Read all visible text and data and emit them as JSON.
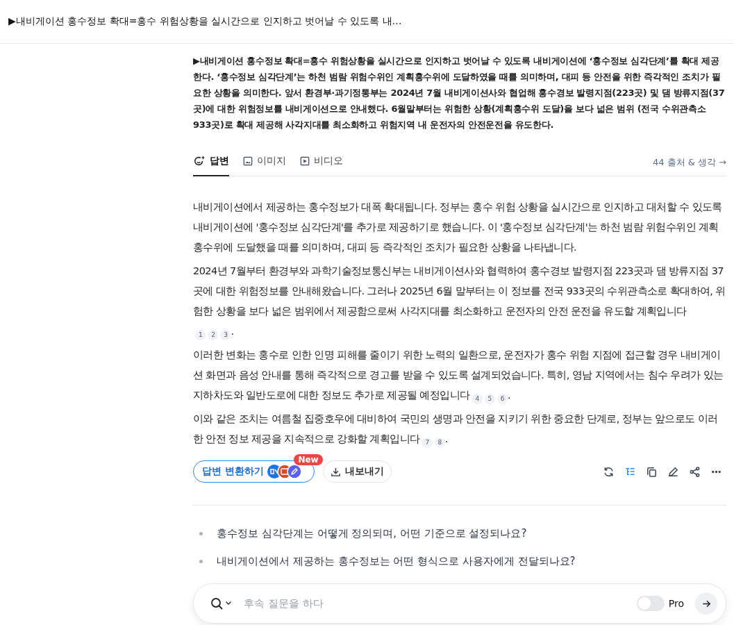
{
  "header": {
    "title": "▶내비게이션 홍수정보 확대=홍수 위험상황을 실시간으로 인지하고 벗어날 수 있도록 내…"
  },
  "query": "▶내비게이션 홍수정보 확대=홍수 위험상황을 실시간으로 인지하고 벗어날 수 있도록 내비게이션에 ‘홍수정보 심각단계’를 확대 제공한다. ‘홍수정보 심각단계’는 하천 범람 위험수위인 계획홍수위에 도달하였을 때를 의미하며, 대피 등 안전을 위한 즉각적인 조치가 필요한 상황을 의미한다. 앞서 환경부·과기정통부는 2024년 7월 내비게이션사와 협업해 홍수경보 발령지점(223곳) 및 댐 방류지점(37곳)에 대한 위험정보를 내비게이션으로 안내했다. 6월말부터는 위험한 상황(계획홍수위 도달)을 보다 넓은 범위 (전국 수위관측소 933곳)로 확대 제공해 사각지대를 최소화하고 위험지역 내 운전자의 안전운전을 유도한다.",
  "tabs": [
    {
      "label": "답변",
      "kind": "answer",
      "selected": true
    },
    {
      "label": "이미지",
      "kind": "images",
      "selected": false
    },
    {
      "label": "비디오",
      "kind": "video",
      "selected": false
    }
  ],
  "sources_link": "44 출처 & 생각 →",
  "paragraphs": [
    {
      "text": "내비게이션에서 제공하는 홍수정보가 대폭 확대됩니다. 정부는 홍수 위험 상황을 실시간으로 인지하고 대처할 수 있도록 내비게이션에 '홍수정보 심각단계'를 추가로 제공하기로 했습니다. 이 '홍수정보 심각단계'는 하천 범람 위험수위인 계획홍수위에 도달했을 때를 의미하며, 대피 등 즉각적인 조치가 필요한 상황을 나타냅니다."
    },
    {
      "text": "2024년 7월부터 환경부와 과학기술정보통신부는 내비게이션사와 협력하여 홍수경보 발령지점 223곳과 댐 방류지점 37곳에 대한 위험정보를 안내해왔습니다. 그러나 2025년 6월 말부터는 이 정보를 전국 933곳의 수위관측소로 확대하여, 위험한 상황을 보다 넓은 범위에서 제공함으로써 사각지대를 최소화하고 운전자의 안전 운전을 유도할 계획입니다",
      "citations": [
        "1",
        "2",
        "3"
      ],
      "end": "."
    },
    {
      "text": "이러한 변화는 홍수로 인한 인명 피해를 줄이기 위한 노력의 일환으로, 운전자가 홍수 위험 지점에 접근할 경우 내비게이션 화면과 음성 안내를 통해 즉각적으로 경고를 받을 수 있도록 설계되었습니다. 특히, 영남 지역에서는 침수 우려가 있는 지하차도와 일반도로에 대한 정보도 추가로 제공될 예정입니다",
      "citations": [
        "4",
        "5",
        "6"
      ],
      "end": "."
    },
    {
      "text": "이와 같은 조치는 여름철 집중호우에 대비하여 국민의 생명과 안전을 지키기 위한 중요한 단계로, 정부는 앞으로도 이러한 안전 정보 제공을 지속적으로 강화할 계획입니다",
      "citations": [
        "7",
        "8"
      ],
      "end": "."
    }
  ],
  "actions": {
    "convert_button": "답변 변환하기",
    "new_badge": "New",
    "export_button": "내보내기"
  },
  "toolbar": [
    {
      "kind": "rewrite",
      "selected": false
    },
    {
      "kind": "outline",
      "selected": true
    },
    {
      "kind": "copy",
      "selected": false
    },
    {
      "kind": "edit",
      "selected": false
    },
    {
      "kind": "share",
      "selected": false
    },
    {
      "kind": "more",
      "selected": false
    }
  ],
  "related": [
    "홍수정보 심각단계는 어떻게 정의되며, 어떤 기준으로 설정되나요?",
    "내비게이션에서 제공하는 홍수정보는 어떤 형식으로 사용자에게 전달되나요?"
  ],
  "input": {
    "placeholder": "후속 질문을 하다",
    "pro_label": "Pro",
    "pro_on": false
  }
}
